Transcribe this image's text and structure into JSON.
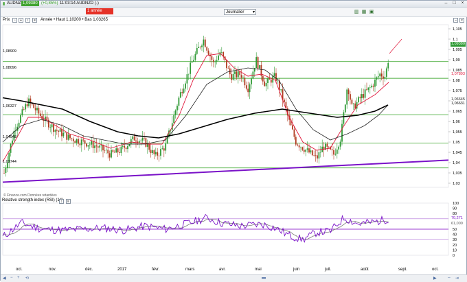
{
  "titlebar": {
    "symbol": "AUDNZD",
    "price": "1,09380",
    "change": "(+0,85%)",
    "time_symbol": "11:03:14 AUDNZD (-)"
  },
  "toolbar": {
    "period": "1 année",
    "frequency": "Journalier"
  },
  "chart": {
    "label": "Prix",
    "header": "Année • Haut 1,10200 • Bas 1,03265",
    "copyright": "© Finance.com Données retardées",
    "h_levels": [
      "1,08909",
      "1,08096",
      "1,06327",
      "1,04948",
      "1,03744"
    ],
    "y_ticks": [
      "1,105",
      "1,1",
      "1,095",
      "1,09",
      "1,085",
      "1,08",
      "1,075",
      "1,07",
      "1,065",
      "1,06",
      "1,055",
      "1,05",
      "1,045",
      "1,04",
      "1,035",
      "1,03"
    ],
    "chips": {
      "last": "1,09380",
      "ma_red": "1,07893",
      "ma_a": "1,06645",
      "ma_b": "1,06631",
      "top": "1,095"
    },
    "colors": {
      "up": "#2f9a35",
      "down": "#b03a1f",
      "ma_short": "#e0193c",
      "ma_mid": "#222222",
      "ma_long": "#000000",
      "trend": "#7a12c8",
      "hline": "#4cae3e"
    }
  },
  "rsi": {
    "title": "Relative strength index (RSI) (14)",
    "y_ticks": [
      "100",
      "90",
      "80",
      "70",
      "60",
      "50",
      "40",
      "30",
      "20",
      "10",
      "0"
    ],
    "chips": {
      "rsi": "70,271",
      "ma": "61,000"
    },
    "levels": [
      70,
      50,
      30
    ]
  },
  "xaxis": [
    "oct.",
    "nov.",
    "déc.",
    "2017",
    "févr.",
    "mars",
    "avr.",
    "mai",
    "juin",
    "juil.",
    "août",
    "sept.",
    "oct."
  ],
  "status": {
    "zoom_out": "−",
    "zoom_in": "+"
  }
}
